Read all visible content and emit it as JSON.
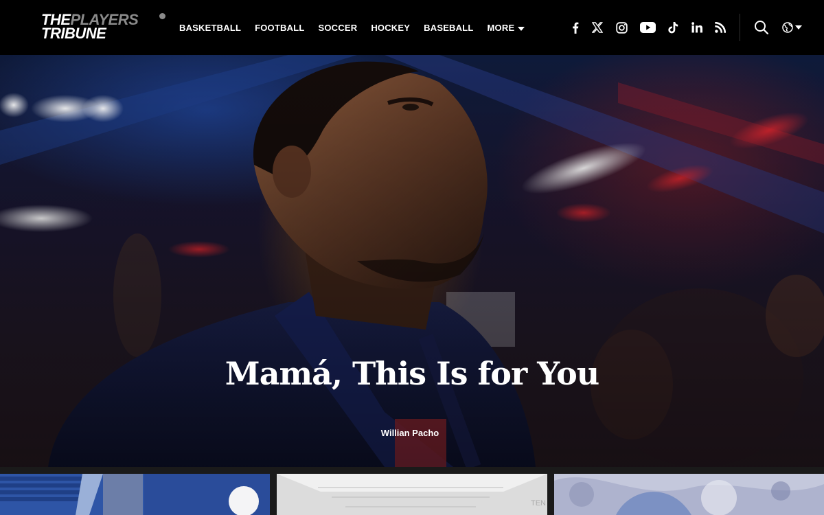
{
  "header": {
    "logo": {
      "line1_a": "THE",
      "line1_b": "PLAYERS",
      "line2": "TRIBUNE"
    },
    "nav": [
      {
        "label": "BASKETBALL"
      },
      {
        "label": "FOOTBALL"
      },
      {
        "label": "SOCCER"
      },
      {
        "label": "HOCKEY"
      },
      {
        "label": "BASEBALL"
      },
      {
        "label": "MORE"
      }
    ],
    "social_icons": [
      "facebook-icon",
      "x-icon",
      "instagram-icon",
      "youtube-icon",
      "tiktok-icon",
      "linkedin-icon",
      "rss-icon"
    ],
    "utility_icons": [
      "search-icon",
      "globe-icon"
    ]
  },
  "hero": {
    "title": "Mamá, This Is for You",
    "author": "Willian Pacho"
  },
  "colors": {
    "header_bg": "#000000",
    "logo_gray": "#8a8a8a",
    "text": "#ffffff"
  }
}
